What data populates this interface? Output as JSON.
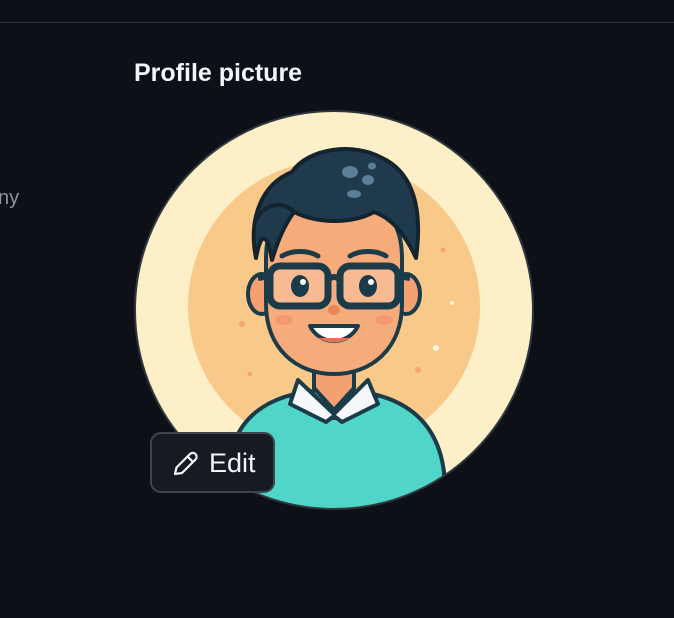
{
  "settings": {
    "cut_off_label": "ny"
  },
  "profile_picture": {
    "title": "Profile picture",
    "edit_label": "Edit",
    "edit_icon": "pencil-icon",
    "colors": {
      "avatar_background": "#fdf0c8",
      "avatar_inner_circle": "#f9c98a",
      "sweater": "#4fd6c8",
      "hair": "#1f3a4d"
    }
  },
  "colors": {
    "page_background": "#0d1117",
    "button_background": "#161b22",
    "border": "#30363d",
    "text_primary": "#f0f6fc",
    "text_muted": "#8b949e"
  }
}
